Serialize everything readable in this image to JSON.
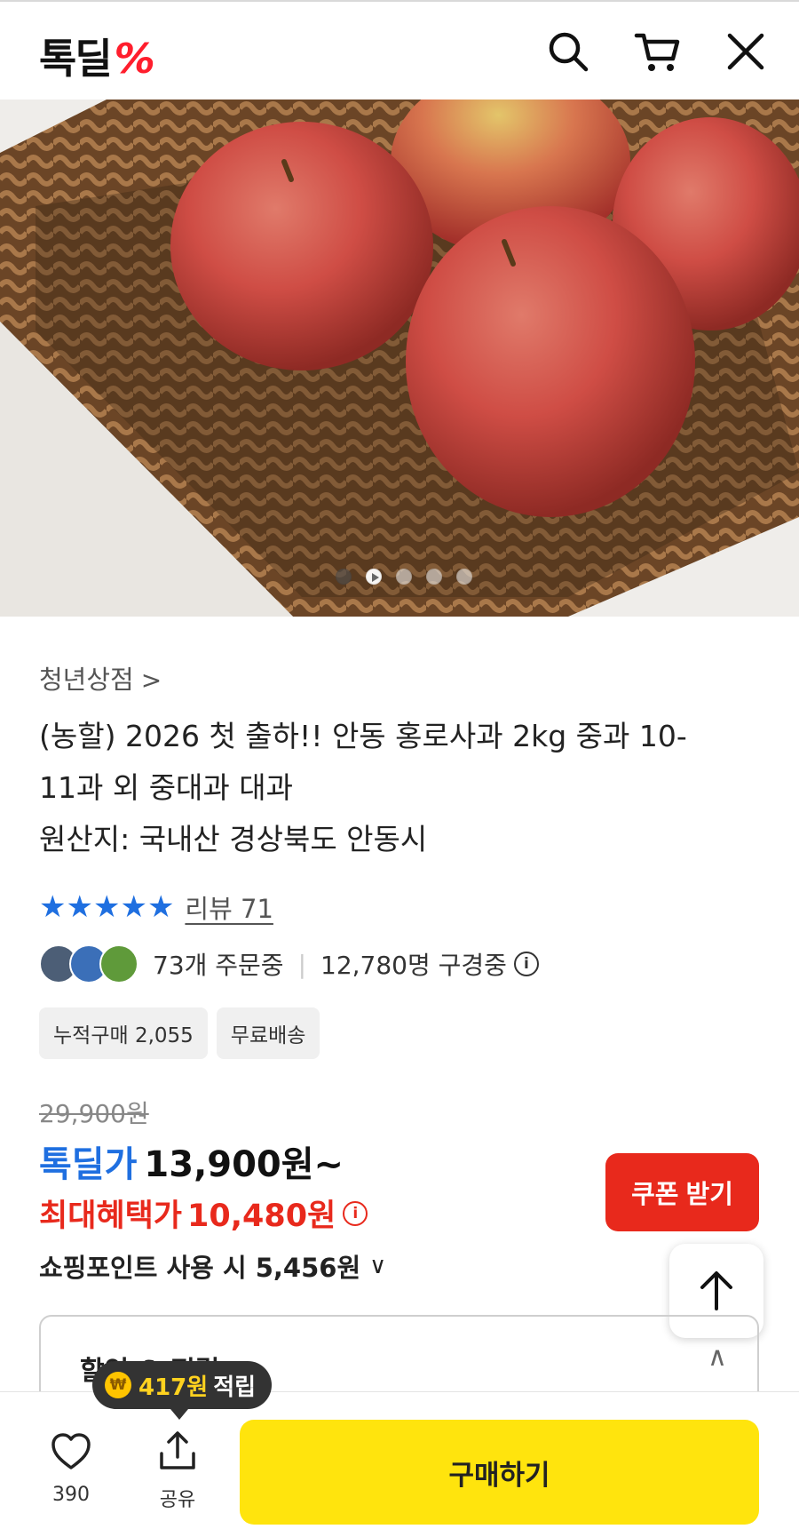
{
  "header": {
    "logo_text": "톡딜",
    "logo_mark": "%",
    "icons": [
      "search-icon",
      "cart-icon",
      "close-icon"
    ]
  },
  "carousel": {
    "total": 5,
    "current": 2
  },
  "product": {
    "store_name": "청년상점",
    "title_line1": "(농할) 2026 첫 출하!! 안동 홍로사과 2kg 중과 10-",
    "title_line2": "11과 외 중대과 대과",
    "title_line3": "원산지: 국내산 경상북도 안동시",
    "rating_stars": 5,
    "review_label": "리뷰 71",
    "orders_text": "73개 주문중",
    "viewers_text": "12,780명 구경중",
    "chips": [
      "누적구매 2,055",
      "무료배송"
    ]
  },
  "price": {
    "original": "29,900원",
    "deal_label": "톡딜가",
    "deal_price": "13,900원~",
    "max_benefit_label": "최대혜택가",
    "max_benefit_price": "10,480원",
    "points_text": "쇼핑포인트 사용 시 5,456원",
    "coupon_button": "쿠폰 받기"
  },
  "discount_section": {
    "title": "할인 & 적립"
  },
  "tooltip": {
    "amount": "417원",
    "suffix": "적립",
    "coin": "₩"
  },
  "bottom_bar": {
    "like_count": "390",
    "share_label": "공유",
    "buy_button": "구매하기"
  },
  "colors": {
    "brand_blue": "#1f6fe0",
    "accent_red": "#e8291c",
    "buy_yellow": "#ffe40d",
    "logo_red": "#ff1e2d"
  }
}
